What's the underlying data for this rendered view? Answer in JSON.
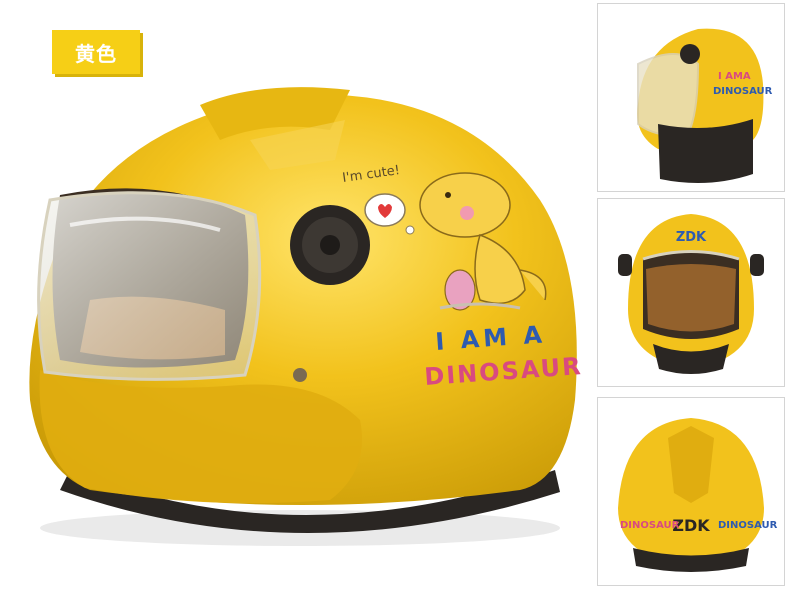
{
  "color_label": "黄色",
  "helmet": {
    "bubble_text": "I'm cute!",
    "line1": "I AM A",
    "line2": "DINOSAUR",
    "brand": "ZDK"
  },
  "colors": {
    "shell": "#f2c21c",
    "shell_shadow": "#c99a06",
    "tag": "#f6cf16",
    "liner": "#2a2623"
  }
}
